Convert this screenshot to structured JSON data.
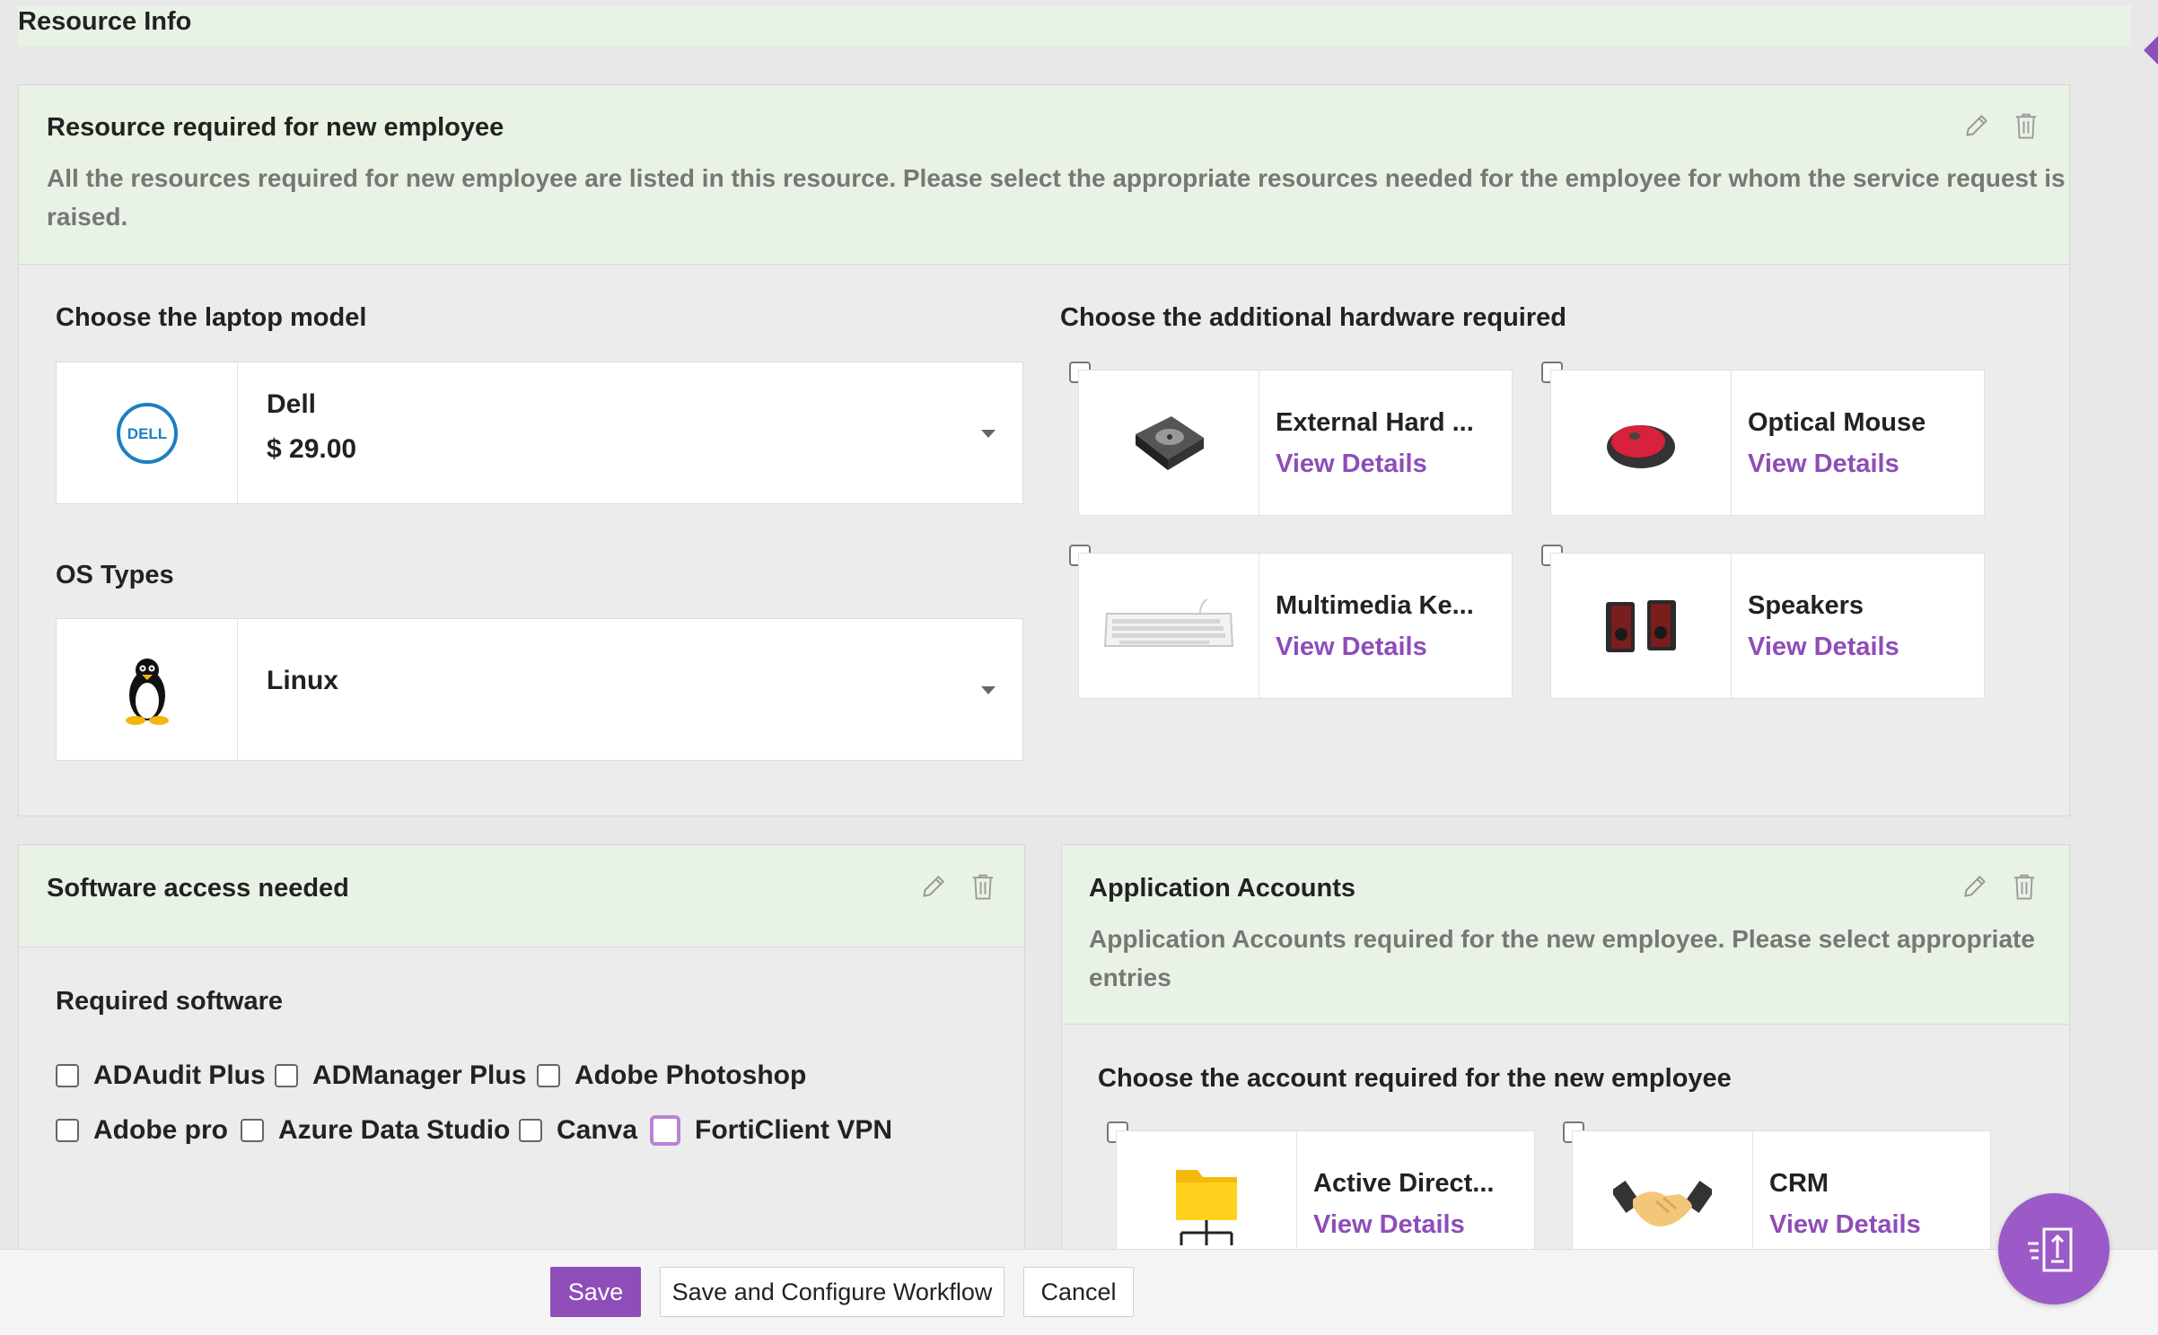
{
  "page": {
    "title": "Resource Info"
  },
  "colors": {
    "accent": "#8e4db8",
    "header_bg": "#e9f3e5",
    "panel_bg": "#ececec"
  },
  "resource_section": {
    "title": "Resource required for new employee",
    "description": "All the resources required for new employee are listed in this resource. Please select the appropriate resources needed for the employee for whom the service request is raised.",
    "laptop": {
      "label": "Choose the laptop model",
      "selected_name": "Dell",
      "selected_price": "$ 29.00",
      "logo_text": "DELL"
    },
    "os": {
      "label": "OS Types",
      "selected": "Linux"
    },
    "hardware": {
      "label": "Choose the additional hardware required",
      "items": [
        {
          "name": "External Hard ...",
          "link": "View Details",
          "icon": "hard-drive-icon"
        },
        {
          "name": "Optical Mouse",
          "link": "View Details",
          "icon": "mouse-icon"
        },
        {
          "name": "Multimedia Ke...",
          "link": "View Details",
          "icon": "keyboard-icon"
        },
        {
          "name": "Speakers",
          "link": "View Details",
          "icon": "speakers-icon"
        }
      ]
    }
  },
  "software_section": {
    "title": "Software access needed",
    "label": "Required software",
    "items": [
      "ADAudit Plus",
      "ADManager Plus",
      "Adobe Photoshop",
      "Adobe pro",
      "Azure Data Studio",
      "Canva",
      "FortiClient VPN"
    ]
  },
  "accounts_section": {
    "title": "Application Accounts",
    "description": "Application Accounts required for the new employee. Please select appropriate entries",
    "label": "Choose the account required for the new employee",
    "items": [
      {
        "name": "Active Direct...",
        "link": "View Details",
        "icon": "folder-network-icon"
      },
      {
        "name": "CRM",
        "link": "View Details",
        "icon": "handshake-icon"
      }
    ]
  },
  "footer": {
    "save": "Save",
    "save_configure": "Save and Configure Workflow",
    "cancel": "Cancel"
  }
}
